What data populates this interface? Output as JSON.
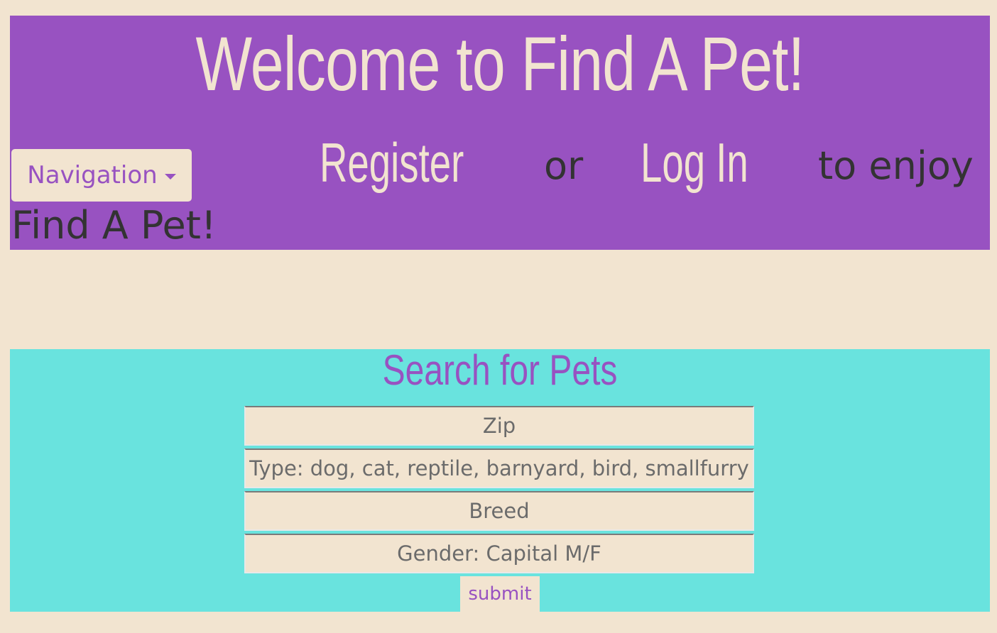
{
  "header": {
    "title": "Welcome to Find A Pet!",
    "nav_button_label": "Navigation",
    "register_link": "Register",
    "or_text": "or",
    "login_link": "Log In",
    "to_enjoy_text": "to enjoy",
    "find_a_pet_text": "Find A Pet!"
  },
  "search": {
    "title": "Search for Pets",
    "zip_placeholder": "Zip",
    "type_placeholder": "Type: dog, cat, reptile, barnyard, bird, smallfurry",
    "breed_placeholder": "Breed",
    "gender_placeholder": "Gender: Capital M/F",
    "submit_label": "submit"
  },
  "colors": {
    "page_bg": "#f2e4d0",
    "header_bg": "#9852c1",
    "search_bg": "#69e3de",
    "accent_text": "#9852c1",
    "dark_text": "#333333"
  },
  "icons": {
    "nav_caret": "caret-down-icon"
  }
}
